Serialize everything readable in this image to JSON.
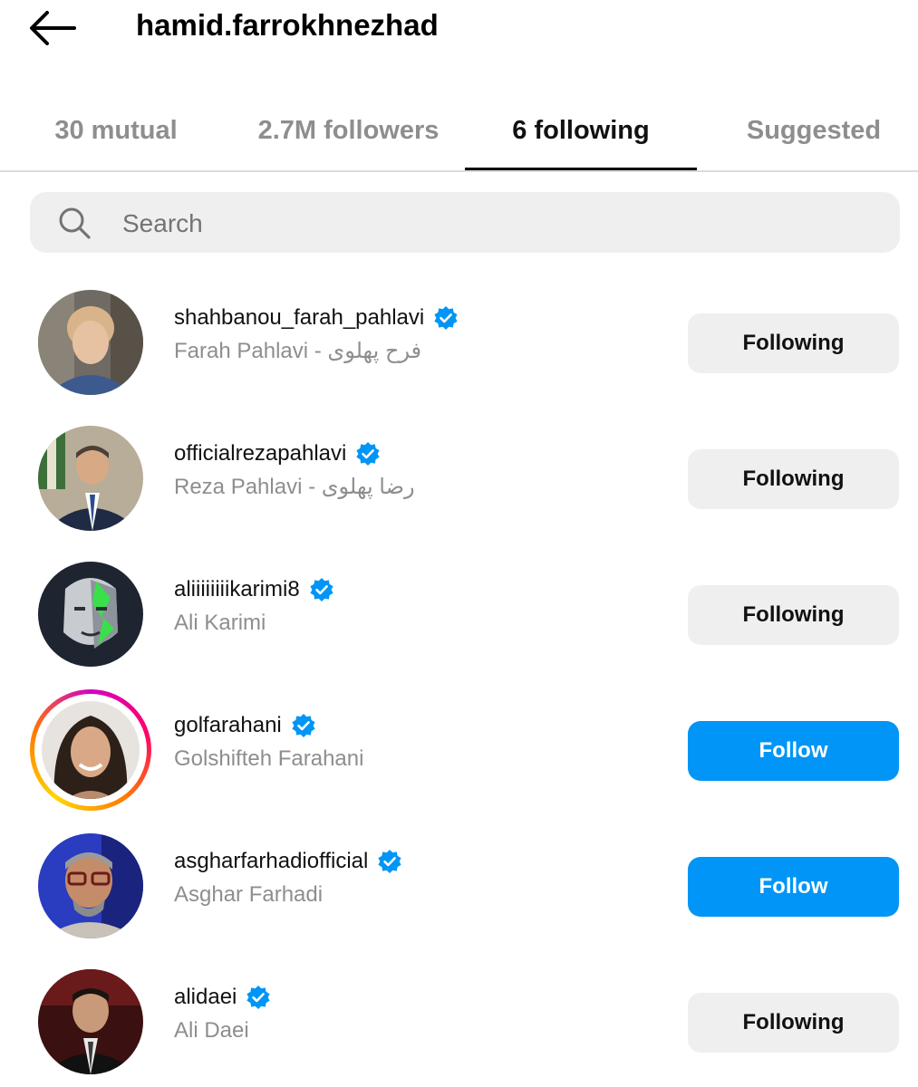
{
  "header": {
    "username": "hamid.farrokhnezhad"
  },
  "tabs": [
    {
      "label": "30 mutual"
    },
    {
      "label": "2.7M followers"
    },
    {
      "label": "6 following"
    },
    {
      "label": "Suggested"
    }
  ],
  "active_tab": "6 following",
  "search": {
    "placeholder": "Search",
    "value": ""
  },
  "users": [
    {
      "username": "shahbanou_farah_pahlavi",
      "name": "Farah Pahlavi - فرح پهلوی",
      "button": "Following",
      "verified": true
    },
    {
      "username": "officialrezapahlavi",
      "name": "Reza Pahlavi - رضا پهلوی",
      "button": "Following",
      "verified": true
    },
    {
      "username": "aliiiiiiiikarimi8",
      "name": "Ali Karimi",
      "button": "Following",
      "verified": true
    },
    {
      "username": "golfarahani",
      "name": "Golshifteh Farahani",
      "button": "Follow",
      "verified": true,
      "story_ring": true
    },
    {
      "username": "asgharfarhadiofficial",
      "name": "Asghar Farhadi",
      "button": "Follow",
      "verified": true
    },
    {
      "username": "alidaei",
      "name": "Ali Daei",
      "button": "Following",
      "verified": true
    }
  ],
  "colors": {
    "follow_blue": "#0095f6",
    "following_gray": "#efefef",
    "verified_blue": "#0095f6",
    "secondary_text": "#8e8e8e"
  },
  "icons": {
    "back": "arrow-left-icon",
    "search": "search-icon",
    "verified": "verified-badge-icon"
  }
}
